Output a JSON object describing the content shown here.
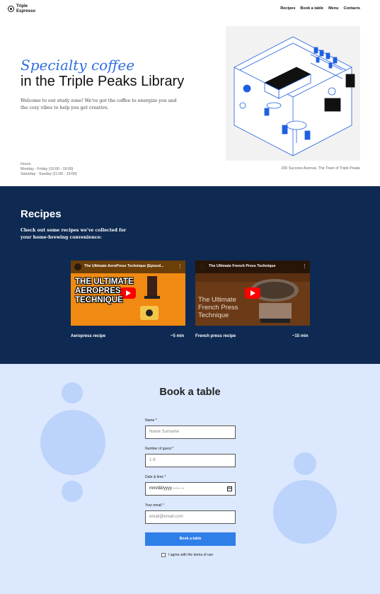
{
  "header": {
    "logo_text": "Triple Espresso",
    "nav": [
      "Recipes",
      "Book a table",
      "Menu",
      "Contacts"
    ]
  },
  "hero": {
    "title_accent": "Specialty coffee",
    "title_main": "in the Triple Peaks Library",
    "description": "Welcome to our study zone! We've got the coffee to energize you and the cozy vibes to help you get creative.",
    "hours_label": "Hours:",
    "hours_weekday": "Monday - Friday (10:00 - 19:00)",
    "hours_weekend": "Saturday - Sunday (11:00 - 19:00)",
    "address": "200 Success Avenue, The Town of Triple Peaks"
  },
  "recipes": {
    "title": "Recipes",
    "description": "Check out some recipes we've collected for your home-brewing convenience:",
    "videos": [
      {
        "title": "The Ultimate AeroPress Technique (Episod...",
        "thumb_text_1": "THE ULTIMATE",
        "thumb_text_2": "AEROPRES",
        "thumb_text_3": "TECHNIQUE",
        "caption": "Aeropress recipe",
        "duration": "~5 min"
      },
      {
        "title": "The Ultimate French Press Technique",
        "thumb_text_1": "The Ultimate",
        "thumb_text_2": "French Press",
        "thumb_text_3": "Technique",
        "caption": "French press recipe",
        "duration": "~15 min"
      }
    ]
  },
  "booking": {
    "title": "Book a table",
    "name_label": "Name *",
    "name_placeholder": "Name Surname",
    "guests_label": "Number of guest *",
    "guests_placeholder": "1-8",
    "datetime_label": "Date & time *",
    "datetime_placeholder": "mm/dd/yyyy  --:-- --",
    "email_label": "Your email *",
    "email_placeholder": "email@email.com",
    "submit_label": "Book a table",
    "agree_label": "I agree with the terms of use"
  },
  "colors": {
    "accent_blue": "#2f6fe0",
    "recipes_bg": "#0e2a52",
    "booking_bg": "#dce8fd",
    "bubble": "#bcd3fb",
    "button": "#2f7fe9",
    "youtube_red": "#ff0000"
  },
  "icons": [
    "logo-icon",
    "youtube-play-icon",
    "more-vert-icon",
    "calendar-icon",
    "checkbox-icon"
  ]
}
